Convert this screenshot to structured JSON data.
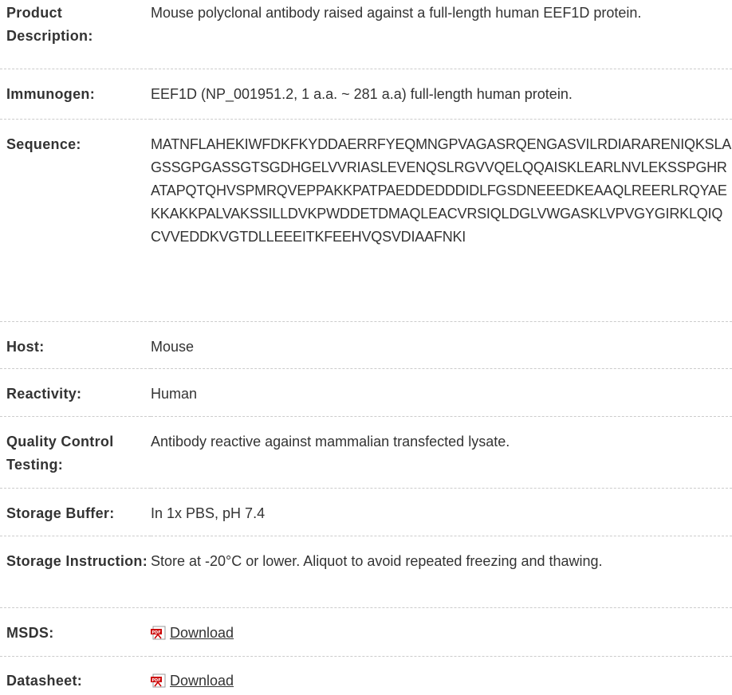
{
  "rows": [
    {
      "label": "Product Description:",
      "value": "Mouse polyclonal antibody raised against a full-length human EEF1D protein."
    },
    {
      "label": "Immunogen:",
      "value": "EEF1D (NP_001951.2, 1 a.a. ~ 281 a.a) full-length human protein."
    },
    {
      "label": "Sequence:",
      "value": "MATNFLAHEKIWFDKFKYDDAERRFYEQMNGPVAGASRQENGASVILRDIARARENIQKSLAGSSGPGASSGTSGDHGELVVRIASLEVENQSLRGVVQELQQAISKLEARLNVLEKSSPGHRATAPQTQHVSPMRQVEPPAKKPATPAEDDEDDDIDLFGSDNEEEDKEAAQLREERLRQYAEKKAKKPALVAKSSILLDVKPWDDETDMAQLEACVRSIQLDGLVWGASKLVPVGYGIRKLQIQCVVEDDKVGTDLLEEEITKFEEHVQSVDIAAFNKI"
    },
    {
      "label": "Host:",
      "value": "Mouse"
    },
    {
      "label": "Reactivity:",
      "value": "Human"
    },
    {
      "label": "Quality Control Testing:",
      "value": "Antibody reactive against mammalian transfected lysate."
    },
    {
      "label": "Storage Buffer:",
      "value": "In 1x PBS, pH 7.4"
    },
    {
      "label": "Storage Instruction:",
      "value": "Store at -20°C or lower. Aliquot to avoid repeated freezing and thawing."
    },
    {
      "label": "MSDS:",
      "link_text": "Download",
      "icon": "pdf-icon"
    },
    {
      "label": "Datasheet:",
      "link_text": "Download",
      "icon": "pdf-icon"
    }
  ],
  "colors": {
    "text": "#333333",
    "divider": "#cccccc",
    "pdf_icon": "#cc0000"
  }
}
